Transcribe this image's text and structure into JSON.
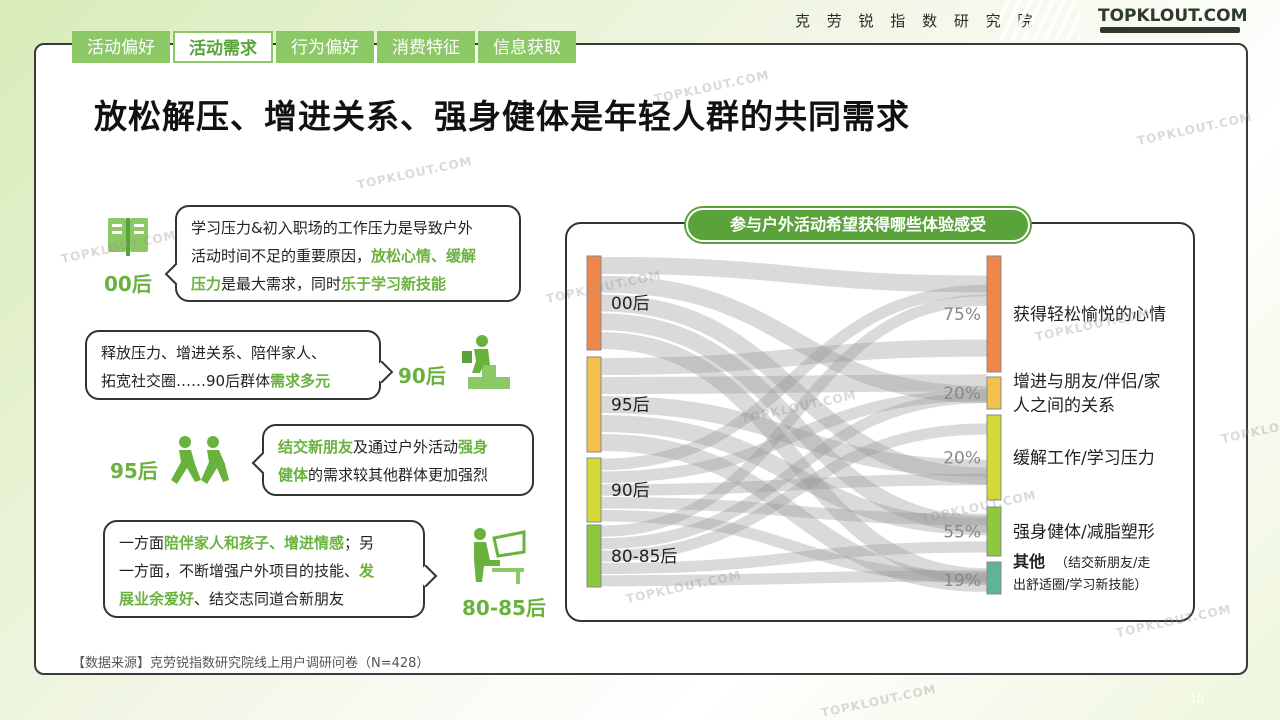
{
  "header": {
    "org": "克 劳 锐 指 数 研 究 院",
    "logo": "TOPKLOUT.COM"
  },
  "tabs": [
    {
      "label": "活动偏好",
      "active": false
    },
    {
      "label": "活动需求",
      "active": true
    },
    {
      "label": "行为偏好",
      "active": false
    },
    {
      "label": "消费特征",
      "active": false
    },
    {
      "label": "信息获取",
      "active": false
    }
  ],
  "title": "放松解压、增进关系、强身健体是年轻人群的共同需求",
  "groups": {
    "g00": {
      "age": "00后",
      "t1": "学习压力&初入职场的工作压力是导致户外",
      "t2": "活动时间不足的重要原因，",
      "h1": "放松心情、缓解",
      "h2": "压力",
      "t3": "是最大需求，同时",
      "h3": "乐于学习新技能"
    },
    "g90": {
      "age": "90后",
      "t1": "释放压力、增进关系、陪伴家人、",
      "t2": "拓宽社交圈……90后群体",
      "h1": "需求多元"
    },
    "g95": {
      "age": "95后",
      "h1": "结交新朋友",
      "t1": "及通过户外活动",
      "h2": "强身",
      "h3": "健体",
      "t2": "的需求较其他群体更加强烈"
    },
    "g80": {
      "age": "80-85后",
      "t1": "一方面",
      "h1": "陪伴家人和孩子、增进情感",
      "t2": "；另",
      "t3": "一方面，不断增强户外项目的技能、",
      "h2": "发",
      "h3": "展业余爱好",
      "t4": "、结交志同道合新朋友"
    }
  },
  "source": "【数据来源】克劳锐指数研究院线上用户调研问卷（N=428）",
  "page_number": "10",
  "watermark": "TOPKLOUT.COM",
  "colors": {
    "accent": "#6ab23e",
    "tab": "#8cc866"
  },
  "chart_data": {
    "type": "sankey",
    "title": "参与户外活动希望获得哪些体验感受",
    "sources": [
      {
        "name": "00后",
        "color": "#f0874a"
      },
      {
        "name": "95后",
        "color": "#f2c14e"
      },
      {
        "name": "90后",
        "color": "#d4da35"
      },
      {
        "name": "80-85后",
        "color": "#8cc840"
      }
    ],
    "targets": [
      {
        "name": "获得轻松愉悦的心情",
        "value_label": "75%",
        "value": 75,
        "color": "#f0874a"
      },
      {
        "name": "增进与朋友/伴侣/家人之间的关系",
        "value_label": "20%",
        "value": 20,
        "color": "#f2c14e"
      },
      {
        "name": "缓解工作/学习压力",
        "value_label": "20%",
        "value": 20,
        "color": "#d4da35"
      },
      {
        "name": "强身健体/减脂塑形",
        "value_label": "55%",
        "value": 55,
        "color": "#8cc840"
      },
      {
        "name": "其他",
        "note": "（结交新朋友/走出舒适圈/学习新技能）",
        "value_label": "19%",
        "value": 19,
        "color": "#5fb39a"
      }
    ],
    "target_lines": {
      "t1": [
        "获得轻松愉悦的心情"
      ],
      "t2": [
        "增进与朋友/伴侣/家",
        "人之间的关系"
      ],
      "t3": [
        "缓解工作/学习压力"
      ],
      "t4": [
        "强身健体/减脂塑形"
      ],
      "t5": [
        "出舒适圈/学习新技能）"
      ],
      "t5a": "其他",
      "t5b": "（结交新朋友/走"
    }
  }
}
